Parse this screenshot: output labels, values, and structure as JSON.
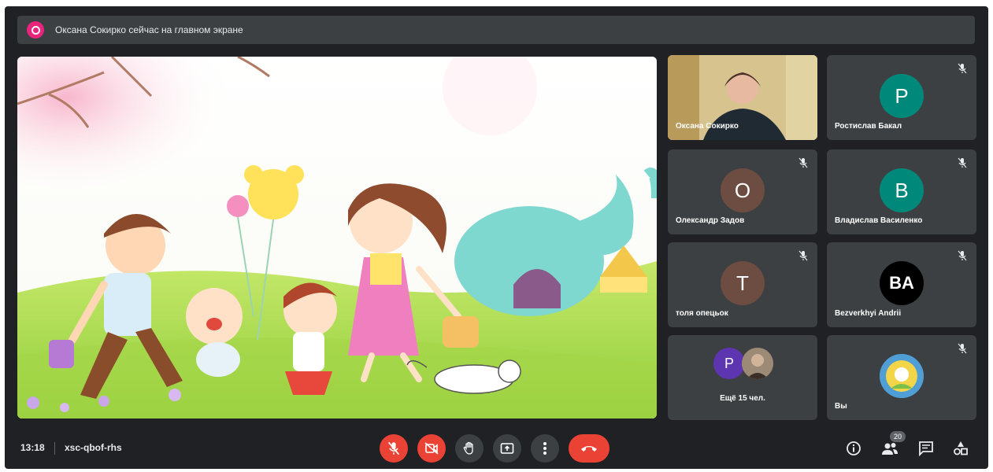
{
  "banner": {
    "text": "Оксана Сокирко сейчас на главном экране",
    "icon": "present-to-all-icon",
    "accent": "#e8247d"
  },
  "participants": [
    {
      "name": "Оксана Сокирко",
      "type": "video"
    },
    {
      "name": "Ростислав Бакал",
      "initial": "P",
      "color": "#00897b",
      "muted": true
    },
    {
      "name": "Олександр Задов",
      "initial": "O",
      "color": "#6d4c41",
      "muted": true
    },
    {
      "name": "Владислав Василенко",
      "initial": "B",
      "color": "#00897b",
      "muted": true
    },
    {
      "name": "толя опецьок",
      "initial": "T",
      "color": "#6d4c41",
      "muted": true
    },
    {
      "name": "Bezverkhyi Andrii",
      "initial": "BA",
      "color": "#000000",
      "muted": false
    }
  ],
  "more": {
    "label": "Ещё 15 чел.",
    "initial": "P",
    "color": "#5e35b1"
  },
  "self": {
    "name": "Вы",
    "muted": true
  },
  "toolbar": {
    "time": "13:18",
    "meeting_code": "xsc-qbof-rhs",
    "people_count": "20",
    "controls": [
      "mic-off-icon",
      "camera-off-icon",
      "raise-hand-icon",
      "present-icon",
      "more-options-icon",
      "end-call-icon"
    ],
    "right_controls": [
      "info-icon",
      "people-icon",
      "chat-icon",
      "activities-icon"
    ]
  },
  "colors": {
    "background": "#202124",
    "tile": "#3c4043",
    "danger": "#ea4335"
  }
}
